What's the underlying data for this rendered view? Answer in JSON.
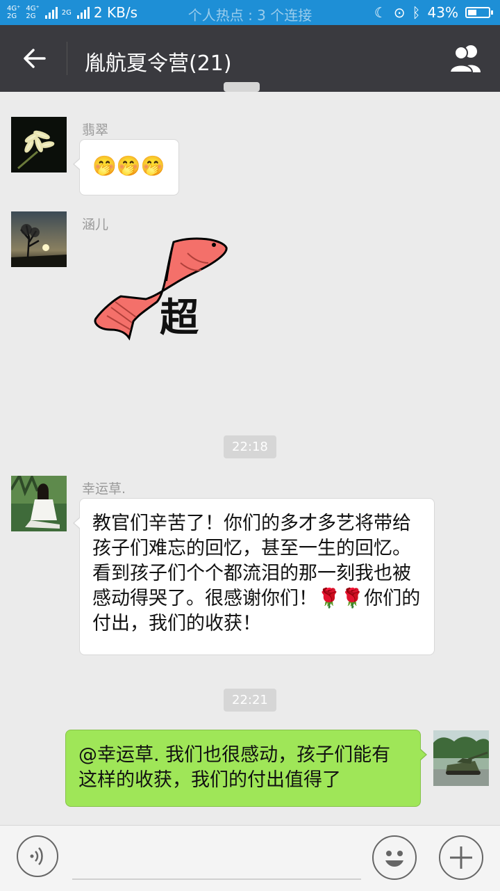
{
  "status_bar": {
    "network_left": [
      "4G⁺",
      "2G"
    ],
    "network_mid": [
      "4G⁺",
      "2G"
    ],
    "network_right": "2G",
    "speed": "2 KB/s",
    "hotspot_text": "个人热点 : 3 个连接",
    "battery_percent": "43%",
    "battery_level": 0.43
  },
  "header": {
    "back_icon": "back-arrow-icon",
    "title": "胤航夏令营(21)",
    "group_icon": "group-members-icon"
  },
  "messages": [
    {
      "sender": "翡翠",
      "content": "🤭🤭🤭",
      "avatar": "flower-photo"
    },
    {
      "sender": "涵儿",
      "sticker_text": "超",
      "avatar": "sunset-tree-photo"
    },
    {
      "time": "22:18"
    },
    {
      "sender": "幸运草.",
      "content": "教官们辛苦了！你们的多才多艺将带给孩子们难忘的回忆，甚至一生的回忆。看到孩子们个个都流泪的那一刻我也被感动得哭了。很感谢你们！🌹🌹你们的付出，我们的收获！",
      "avatar": "woman-in-forest-photo"
    },
    {
      "time": "22:21"
    },
    {
      "self_content": "@幸运草. 我们也很感动，孩子们能有这样的收获，我们的付出值得了",
      "avatar": "tank-photo"
    }
  ],
  "input_bar": {
    "voice_icon": "voice-icon",
    "emoji_icon": "emoji-icon",
    "plus_icon": "plus-icon"
  },
  "colors": {
    "status_bar": "#1e8fd6",
    "title_bar": "#3a3a3f",
    "self_bubble": "#9fe658",
    "background": "#ebebeb"
  }
}
